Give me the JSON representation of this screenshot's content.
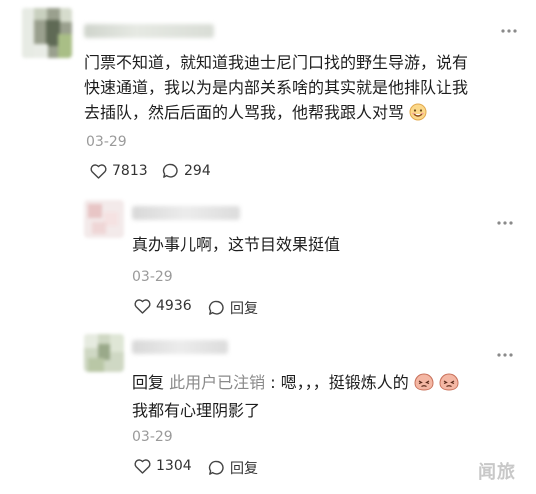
{
  "comments": [
    {
      "more_icon": "more-dots-icon",
      "text_lines": [
        "门票不知道，就知道我迪士尼门口找的野生导游，说有",
        "快速通道，我以为是内部关系啥的其实就是他排队让我",
        "去插队，然后后面的人骂我，他帮我跟人对骂"
      ],
      "date": "03-29",
      "like_count": "7813",
      "comment_count": "294"
    },
    {
      "more_icon": "more-dots-icon",
      "text": "真办事儿啊，这节目效果挺值",
      "date": "03-29",
      "like_count": "4936",
      "reply_label": "回复"
    },
    {
      "more_icon": "more-dots-icon",
      "reply_prefix": "回复",
      "reply_target": "此用户已注销",
      "separator": ":",
      "text_line1": "嗯，，，挺锻炼人的",
      "text_line2": "我都有心理阴影了",
      "date": "03-29",
      "like_count": "1304",
      "reply_label": "回复"
    }
  ],
  "watermark": "闻旅",
  "colors": {
    "text": "#1d1d1d",
    "muted": "#8a8a8a",
    "date": "#9a9a9a"
  }
}
